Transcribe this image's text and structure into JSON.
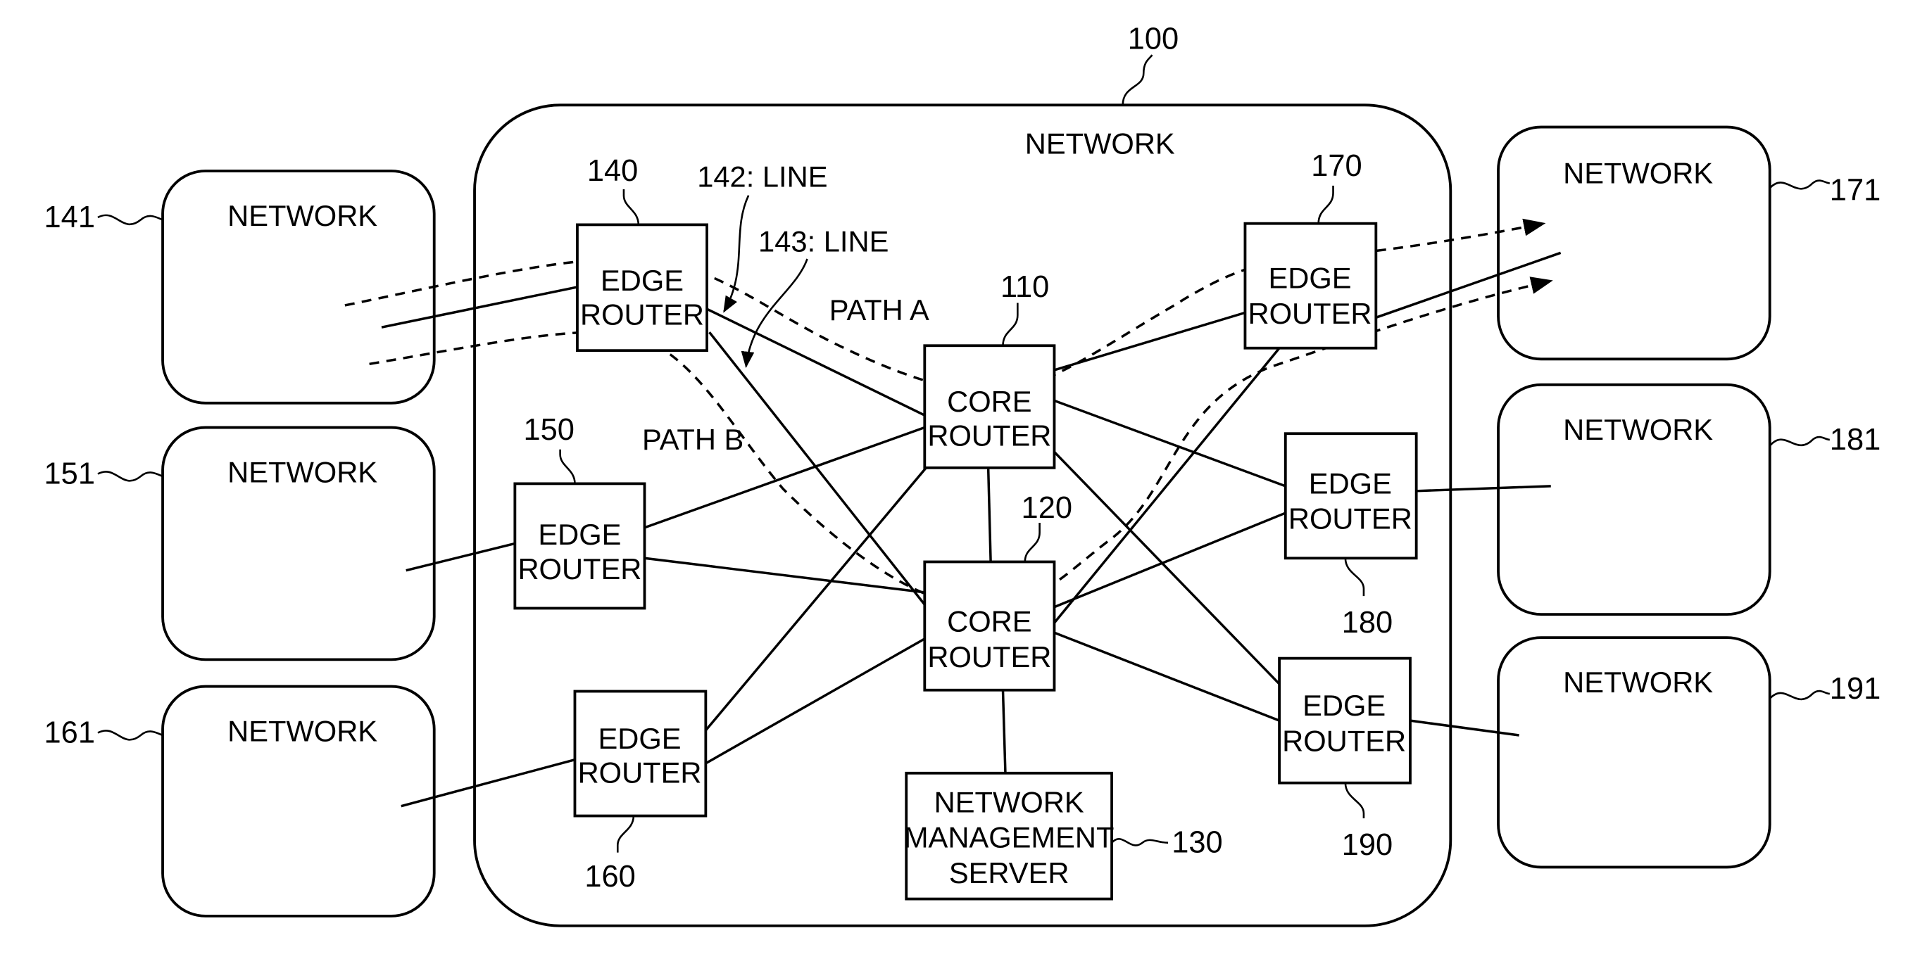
{
  "title_ref": "100",
  "main_network_label": "NETWORK",
  "core_routers": [
    {
      "ref": "110",
      "line1": "CORE",
      "line2": "ROUTER"
    },
    {
      "ref": "120",
      "line1": "CORE",
      "line2": "ROUTER"
    }
  ],
  "management_server": {
    "ref": "130",
    "line1": "NETWORK",
    "line2": "MANAGEMENT",
    "line3": "SERVER"
  },
  "edge_routers": [
    {
      "ref": "140",
      "line1": "EDGE",
      "line2": "ROUTER"
    },
    {
      "ref": "150",
      "line1": "EDGE",
      "line2": "ROUTER"
    },
    {
      "ref": "160",
      "line1": "EDGE",
      "line2": "ROUTER"
    },
    {
      "ref": "170",
      "line1": "EDGE",
      "line2": "ROUTER"
    },
    {
      "ref": "180",
      "line1": "EDGE",
      "line2": "ROUTER"
    },
    {
      "ref": "190",
      "line1": "EDGE",
      "line2": "ROUTER"
    }
  ],
  "external_networks": [
    {
      "ref": "141",
      "label": "NETWORK"
    },
    {
      "ref": "151",
      "label": "NETWORK"
    },
    {
      "ref": "161",
      "label": "NETWORK"
    },
    {
      "ref": "171",
      "label": "NETWORK"
    },
    {
      "ref": "181",
      "label": "NETWORK"
    },
    {
      "ref": "191",
      "label": "NETWORK"
    }
  ],
  "line_labels": {
    "line142": "142: LINE",
    "line143": "143: LINE"
  },
  "path_labels": {
    "path_a": "PATH A",
    "path_b": "PATH B"
  }
}
